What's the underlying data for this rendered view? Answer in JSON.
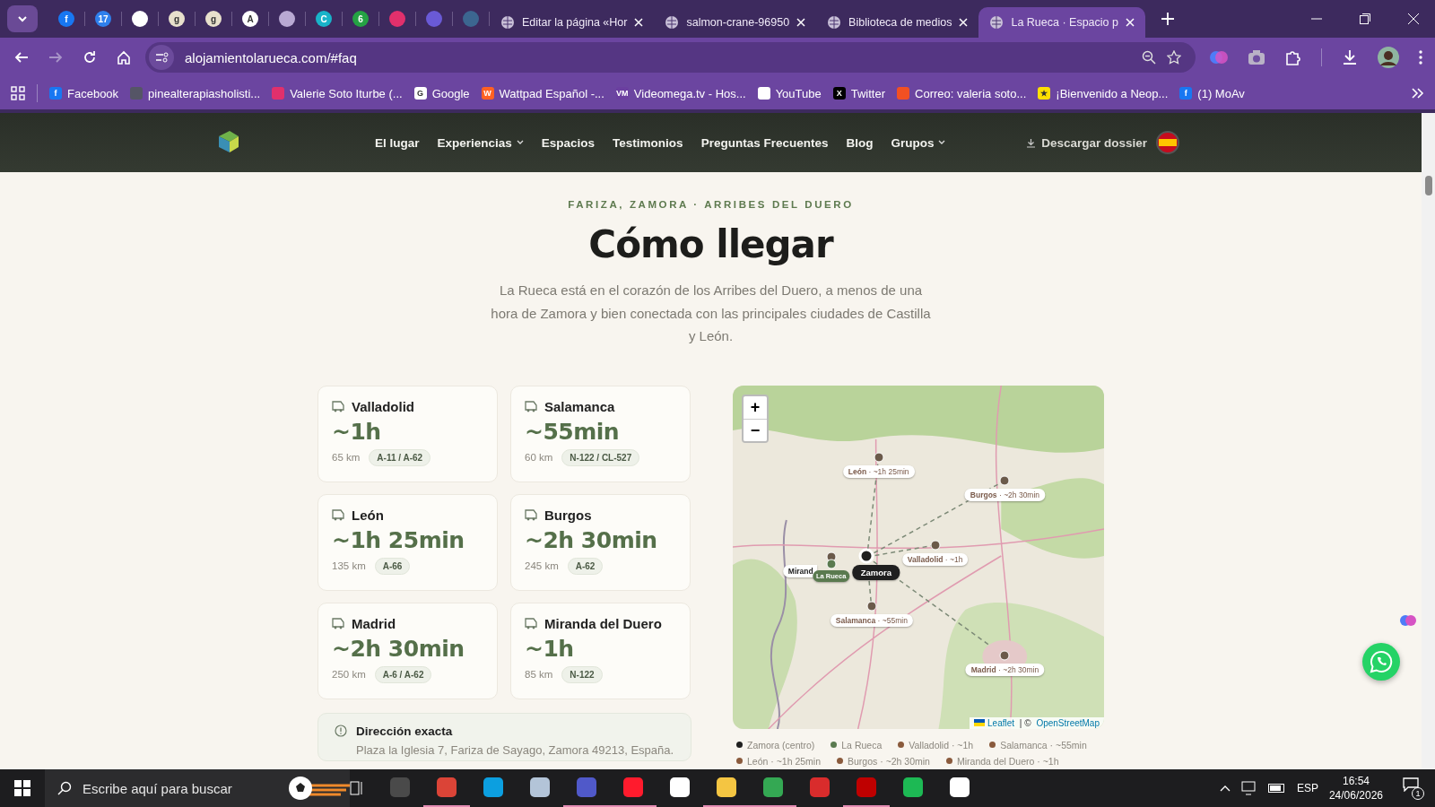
{
  "browser": {
    "pinned_tabs": [
      {
        "glyph": "f",
        "color": "#1877f2"
      },
      {
        "glyph": "17",
        "color": "#2f80ed"
      },
      {
        "color": "#ffffff"
      },
      {
        "glyph": "g",
        "color": "#e8e0cc"
      },
      {
        "glyph": "g",
        "color": "#e8e0cc"
      },
      {
        "glyph": "A",
        "color": "#ffffff"
      },
      {
        "color": "#b9a9d3"
      },
      {
        "glyph": "C",
        "color": "#19b3c9"
      },
      {
        "glyph": "6",
        "color": "#25a244"
      },
      {
        "color": "#e1306c"
      },
      {
        "color": "#6a5ad6"
      },
      {
        "color": "#3c6690"
      }
    ],
    "tabs": [
      {
        "title": "Editar la página «Hor",
        "selected": false
      },
      {
        "title": "salmon-crane-96950",
        "selected": false
      },
      {
        "title": "Biblioteca de medios",
        "selected": false
      },
      {
        "title": "La Rueca · Espacio p",
        "selected": true
      }
    ],
    "address": "alojamientolarueca.com/#faq",
    "bookmarks": [
      {
        "title": "Facebook",
        "glyph": "f",
        "color": "#1877f2"
      },
      {
        "title": "pinealterapiasholisti...",
        "color": "#555566"
      },
      {
        "title": "Valerie Soto Iturbe (...",
        "color": "#e1306c"
      },
      {
        "title": "Google",
        "glyph": "G",
        "color": "#ffffff"
      },
      {
        "title": "Wattpad Español -...",
        "glyph": "W",
        "color": "#ff6122"
      },
      {
        "title": "Videomega.tv - Hos...",
        "glyph": "VM",
        "color": "#6b3fa0"
      },
      {
        "title": "YouTube",
        "color": "#ffffff"
      },
      {
        "title": "Twitter",
        "glyph": "X",
        "color": "#000000"
      },
      {
        "title": "Correo: valeria soto...",
        "color": "#f25022"
      },
      {
        "title": "¡Bienvenido a Neop...",
        "glyph": "★",
        "color": "#ffe000"
      },
      {
        "title": "(1) MoAv",
        "glyph": "f",
        "color": "#1877f2"
      }
    ]
  },
  "site": {
    "nav": [
      {
        "label": "El lugar",
        "dropdown": false
      },
      {
        "label": "Experiencias",
        "dropdown": true
      },
      {
        "label": "Espacios",
        "dropdown": false
      },
      {
        "label": "Testimonios",
        "dropdown": false
      },
      {
        "label": "Preguntas Frecuentes",
        "dropdown": false
      },
      {
        "label": "Blog",
        "dropdown": false
      },
      {
        "label": "Grupos",
        "dropdown": true
      }
    ],
    "download": "Descargar dossier",
    "eyebrow": "FARIZA, ZAMORA · ARRIBES DEL DUERO",
    "title": "Cómo llegar",
    "intro": "La Rueca está en el corazón de los Arribes del Duero, a menos de una hora de Zamora y bien conectada con las principales ciudades de Castilla y León.",
    "routes": [
      {
        "city": "Valladolid",
        "time": "~1h",
        "distance": "65 km",
        "road": "A-11 / A-62"
      },
      {
        "city": "Salamanca",
        "time": "~55min",
        "distance": "60 km",
        "road": "N-122 / CL-527"
      },
      {
        "city": "León",
        "time": "~1h 25min",
        "distance": "135 km",
        "road": "A-66"
      },
      {
        "city": "Burgos",
        "time": "~2h 30min",
        "distance": "245 km",
        "road": "A-62"
      },
      {
        "city": "Madrid",
        "time": "~2h 30min",
        "distance": "250 km",
        "road": "A-6 / A-62"
      },
      {
        "city": "Miranda del Duero",
        "time": "~1h",
        "distance": "85 km",
        "road": "N-122"
      }
    ],
    "address_box": {
      "title": "Dirección exacta",
      "text": "Plaza la Iglesia 7, Fariza de Sayago, Zamora 49213, España."
    },
    "map": {
      "zoom_in": "+",
      "zoom_out": "−",
      "attribution": {
        "link1": "Leaflet",
        "sep": " | © ",
        "link2": "OpenStreetMap"
      },
      "markers": [
        {
          "kind": "town",
          "label": "**León** · ~1h 25min",
          "color": "#6b5a4a"
        },
        {
          "kind": "town",
          "label": "**Burgos** · ~2h 30min",
          "color": "#6b5a4a"
        },
        {
          "kind": "town",
          "label": "**Valladolid** · ~1h",
          "color": "#6b5a4a"
        },
        {
          "kind": "cut",
          "label": "Mirand",
          "color": "#6b5a4a"
        },
        {
          "kind": "town",
          "label": "**Salamanca** · ~55min",
          "color": "#6b5a4a"
        },
        {
          "kind": "town",
          "label": "**Madrid** · ~2h 30min",
          "color": "#6b5a4a"
        },
        {
          "kind": "home",
          "label": "La Rueca",
          "color": "#5a7a4f"
        },
        {
          "kind": "center",
          "label": "Zamora",
          "color": "#1f1f1f"
        }
      ]
    },
    "legend": [
      {
        "label": "Zamora (centro)",
        "color": "#1f1f1f"
      },
      {
        "label": "La Rueca",
        "color": "#5a7a4f"
      },
      {
        "label": "Valladolid · ~1h",
        "color": "#8a5a3c"
      },
      {
        "label": "Salamanca · ~55min",
        "color": "#8a5a3c"
      },
      {
        "label": "León · ~1h 25min",
        "color": "#8a5a3c"
      },
      {
        "label": "Burgos · ~2h 30min",
        "color": "#8a5a3c"
      },
      {
        "label": "Miranda del Duero · ~1h",
        "color": "#8a5a3c"
      }
    ]
  },
  "taskbar": {
    "search": "Escribe aquí para buscar",
    "apps": [
      {
        "color": "#4a4a4a",
        "active": false
      },
      {
        "color": "#db4437",
        "active": true
      },
      {
        "color": "#0c9fe0",
        "active": false
      },
      {
        "color": "#b3c4d8",
        "active": false
      },
      {
        "color": "#5059c9",
        "active": true
      },
      {
        "color": "#ff1b2d",
        "active": true
      },
      {
        "color": "#ffffff",
        "active": false
      },
      {
        "color": "#f4c542",
        "active": true
      },
      {
        "color": "#34a853",
        "active": true
      },
      {
        "color": "#d92c2c",
        "active": false
      },
      {
        "color": "#bf0000",
        "active": true
      },
      {
        "color": "#1db954",
        "active": false
      },
      {
        "color": "#ffffff",
        "active": false
      }
    ],
    "lang": "ESP",
    "time": "16:54",
    "date": "24/06/2026",
    "notifications": "1"
  }
}
